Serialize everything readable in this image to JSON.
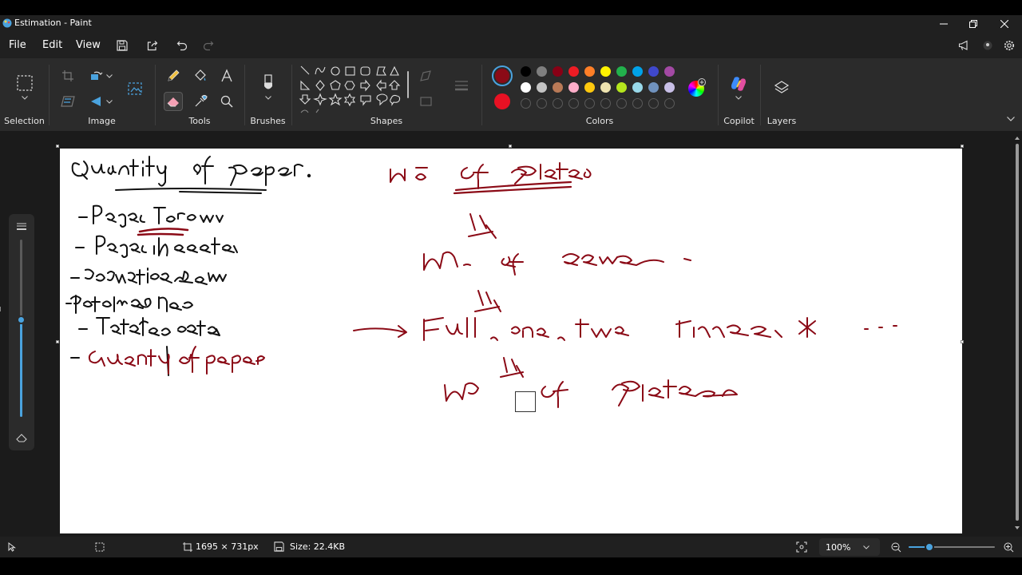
{
  "window": {
    "title": "Estimation - Paint"
  },
  "menu": {
    "file": "File",
    "edit": "Edit",
    "view": "View"
  },
  "ribbon": {
    "groups": {
      "selection": "Selection",
      "image": "Image",
      "tools": "Tools",
      "brushes": "Brushes",
      "shapes": "Shapes",
      "colors": "Colors",
      "copilot": "Copilot",
      "layers": "Layers"
    },
    "primary_color": "#8b0a16",
    "secondary_color": "#e81123",
    "palette_row1": [
      "#000000",
      "#7f7f7f",
      "#880015",
      "#ed1c24",
      "#ff7f27",
      "#fff200",
      "#22b14c",
      "#00a2e8",
      "#3f48cc",
      "#a349a4"
    ],
    "palette_row2": [
      "#ffffff",
      "#c3c3c3",
      "#b97a57",
      "#ffaec9",
      "#ffc90e",
      "#efe4b0",
      "#b5e61d",
      "#99d9ea",
      "#7092be",
      "#c8bfe7"
    ]
  },
  "status": {
    "canvas_size": "1695 × 731px",
    "file_size": "Size: 22.4KB",
    "zoom": "100%",
    "zoom_fraction": 0.24
  },
  "brush_size_fraction": 0.55
}
